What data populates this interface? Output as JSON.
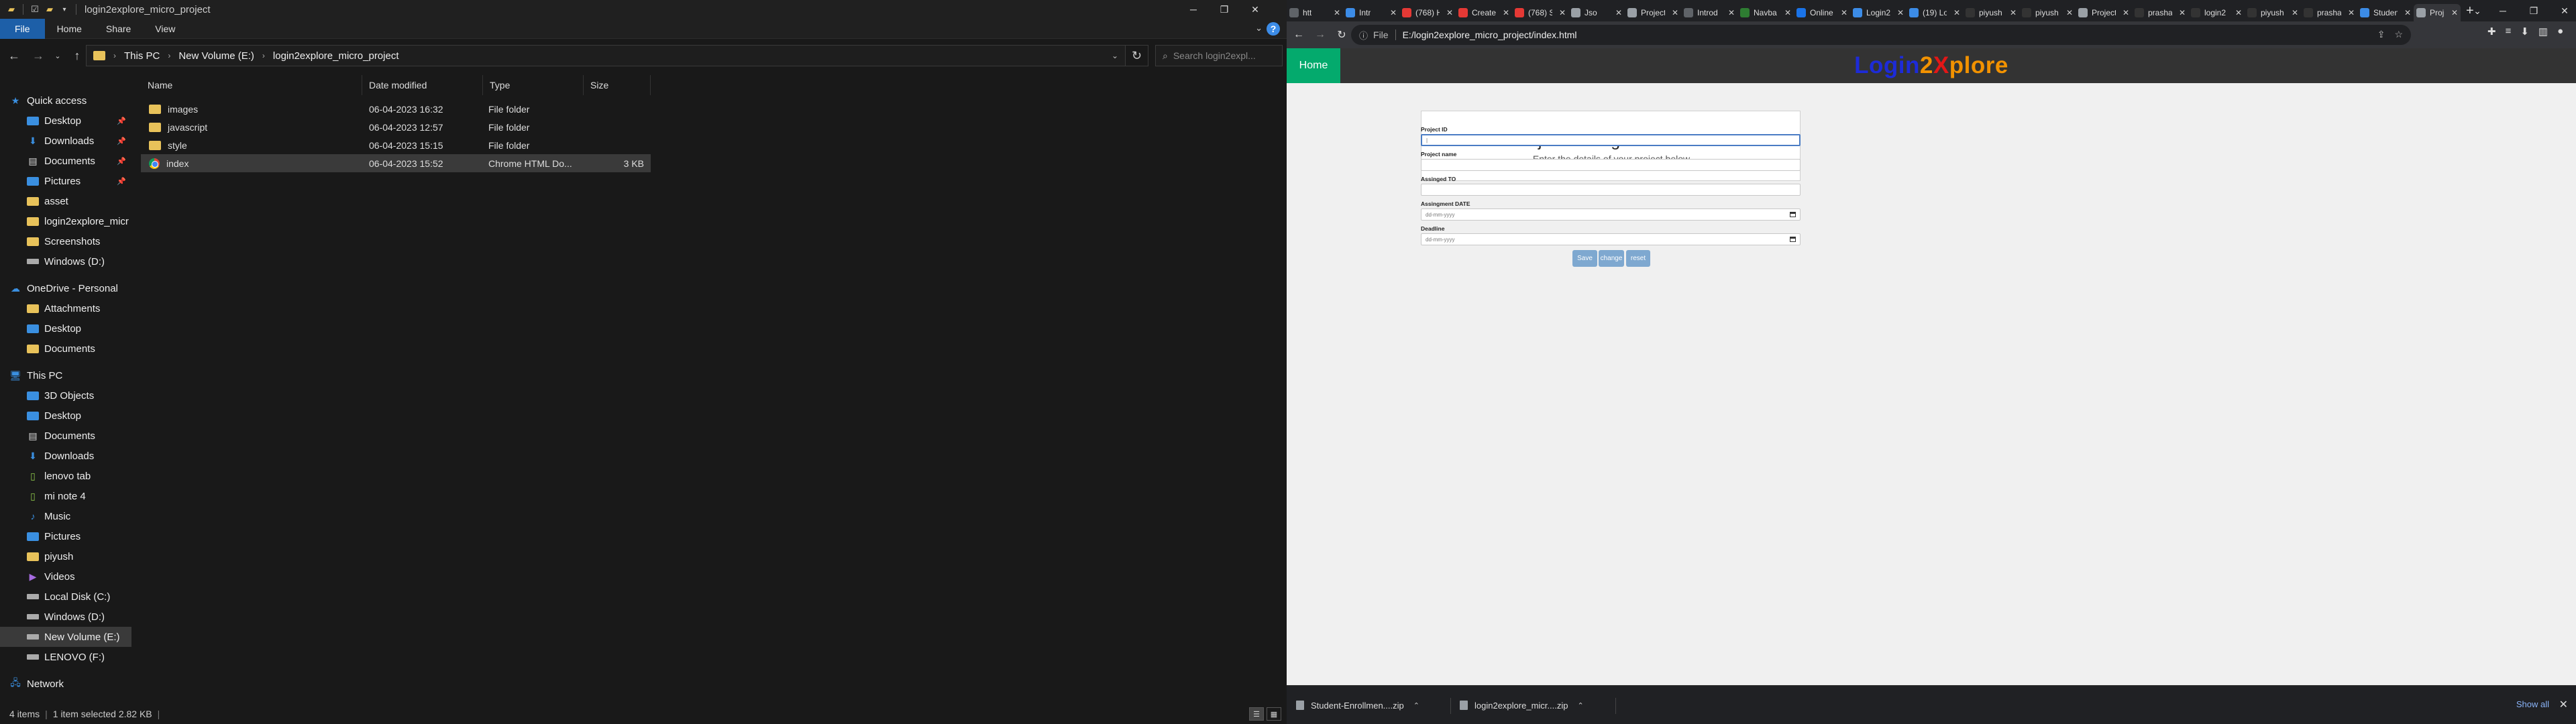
{
  "explorer": {
    "title": "login2explore_micro_project",
    "ribbon_tabs": [
      "File",
      "Home",
      "Share",
      "View"
    ],
    "address": {
      "crumbs": [
        "This PC",
        "New Volume (E:)",
        "login2explore_micro_project"
      ]
    },
    "search_placeholder": "Search login2expl...",
    "nav": {
      "quick_access": "Quick access",
      "quick_items": [
        "Desktop",
        "Downloads",
        "Documents",
        "Pictures",
        "asset",
        "login2explore_micr",
        "Screenshots",
        "Windows (D:)"
      ],
      "onedrive": "OneDrive - Personal",
      "onedrive_items": [
        "Attachments",
        "Desktop",
        "Documents"
      ],
      "this_pc": "This PC",
      "pc_items": [
        "3D Objects",
        "Desktop",
        "Documents",
        "Downloads",
        "lenovo tab",
        "mi note 4",
        "Music",
        "Pictures",
        "piyush",
        "Videos",
        "Local Disk (C:)",
        "Windows (D:)",
        "New Volume (E:)",
        "LENOVO (F:)"
      ],
      "network": "Network"
    },
    "columns": [
      "Name",
      "Date modified",
      "Type",
      "Size"
    ],
    "files": [
      {
        "name": "images",
        "date": "06-04-2023 16:32",
        "type": "File folder",
        "size": ""
      },
      {
        "name": "javascript",
        "date": "06-04-2023 12:57",
        "type": "File folder",
        "size": ""
      },
      {
        "name": "style",
        "date": "06-04-2023 15:15",
        "type": "File folder",
        "size": ""
      },
      {
        "name": "index",
        "date": "06-04-2023 15:52",
        "type": "Chrome HTML Do...",
        "size": "3 KB"
      }
    ],
    "status": {
      "items": "4 items",
      "selected": "1 item selected  2.82 KB"
    }
  },
  "browser": {
    "tabs": [
      "htt",
      "Intr",
      "(768) H",
      "Create",
      "(768) S",
      "Jso",
      "Project",
      "Introd",
      "Navba",
      "Online",
      "Login2",
      "(19) Lo",
      "piyush",
      "piyush",
      "Project",
      "prasha",
      "login2",
      "piyush",
      "prasha",
      "Studen",
      "Proj"
    ],
    "url_prefix": "File",
    "url": "E:/login2explore_micro_project/index.html",
    "page": {
      "home": "Home",
      "brand_1": "Login",
      "brand_2": "2",
      "brand_3": "X",
      "brand_4": "plore",
      "form_title": "Project Management Form",
      "form_subtitle": "Enter the details of your project below",
      "fields": [
        {
          "label": "Project ID",
          "value": "|"
        },
        {
          "label": "Project name",
          "value": ""
        },
        {
          "label": "Assinged TO",
          "value": ""
        },
        {
          "label": "Assingment DATE",
          "value": "dd-mm-yyyy"
        },
        {
          "label": "Deadline",
          "value": "dd-mm-yyyy"
        }
      ],
      "buttons": [
        "Save",
        "change",
        "reset"
      ]
    },
    "downloads": [
      "Student-Enrollmen....zip",
      "login2explore_micr....zip"
    ],
    "show_all": "Show all"
  }
}
